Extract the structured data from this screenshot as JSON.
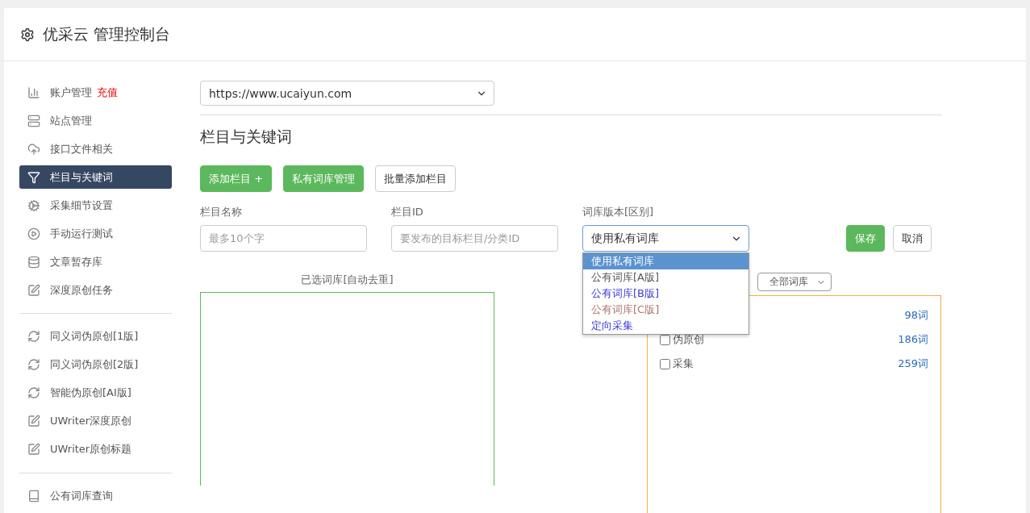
{
  "header": {
    "title": "优采云 管理控制台"
  },
  "sidebar": {
    "groups": [
      [
        {
          "label": "账户管理",
          "badge": "充值",
          "kind": "chart",
          "selected": false
        },
        {
          "label": "站点管理",
          "kind": "server",
          "selected": false
        },
        {
          "label": "接口文件相关",
          "kind": "cloud",
          "selected": false
        },
        {
          "label": "栏目与关键词",
          "kind": "filter",
          "selected": true
        },
        {
          "label": "采集细节设置",
          "kind": "cogs",
          "selected": false
        },
        {
          "label": "手动运行测试",
          "kind": "play",
          "selected": false
        },
        {
          "label": "文章暂存库",
          "kind": "database",
          "selected": false
        },
        {
          "label": "深度原创任务",
          "kind": "edit",
          "selected": false
        }
      ],
      [
        {
          "label": "同义词伪原创[1版]",
          "kind": "refresh",
          "selected": false
        },
        {
          "label": "同义词伪原创[2版]",
          "kind": "refresh",
          "selected": false
        },
        {
          "label": "智能伪原创[AI版]",
          "kind": "refresh",
          "selected": false
        },
        {
          "label": "UWriter深度原创",
          "kind": "edit",
          "selected": false
        },
        {
          "label": "UWriter原创标题",
          "kind": "edit",
          "selected": false
        }
      ],
      [
        {
          "label": "公有词库查询",
          "kind": "book",
          "selected": false
        }
      ]
    ]
  },
  "site_select": {
    "value": "https://www.ucaiyun.com"
  },
  "section_title": "栏目与关键词",
  "actions": [
    {
      "label": "添加栏目 +",
      "kind": "primary"
    },
    {
      "label": "私有词库管理",
      "kind": "primary"
    },
    {
      "label": "批量添加栏目",
      "kind": "default"
    }
  ],
  "form": {
    "fields": [
      {
        "kind": "input",
        "label": "栏目名称",
        "placeholder": "最多10个字"
      },
      {
        "kind": "input",
        "label": "栏目ID",
        "placeholder": "要发布的目标栏目/分类ID"
      },
      {
        "kind": "select",
        "label": "词库版本[区别]",
        "value": "使用私有词库",
        "expanded": true,
        "options": [
          {
            "label": "使用私有词库",
            "selected": true
          },
          {
            "label": "公有词库[A版]",
            "selected": false,
            "color": "#555555"
          },
          {
            "label": "公有词库[B版]",
            "selected": false,
            "color": "#3b3bd6"
          },
          {
            "label": "公有词库[C版]",
            "selected": false,
            "color": "#b07070"
          },
          {
            "label": "定向采集",
            "selected": false,
            "color": "#3b3bd6"
          }
        ]
      }
    ],
    "buttons": [
      {
        "label": "保存",
        "kind": "primary"
      },
      {
        "label": "取消",
        "kind": "default"
      }
    ]
  },
  "selected_panel": {
    "title": "已选词库[自动去重]"
  },
  "library_filter": {
    "value": "全部词库"
  },
  "library_rows": [
    {
      "count": "98词"
    },
    {
      "label": "伪原创",
      "checked": false,
      "count": "186词"
    },
    {
      "label": "采集",
      "checked": false,
      "count": "259词"
    }
  ]
}
